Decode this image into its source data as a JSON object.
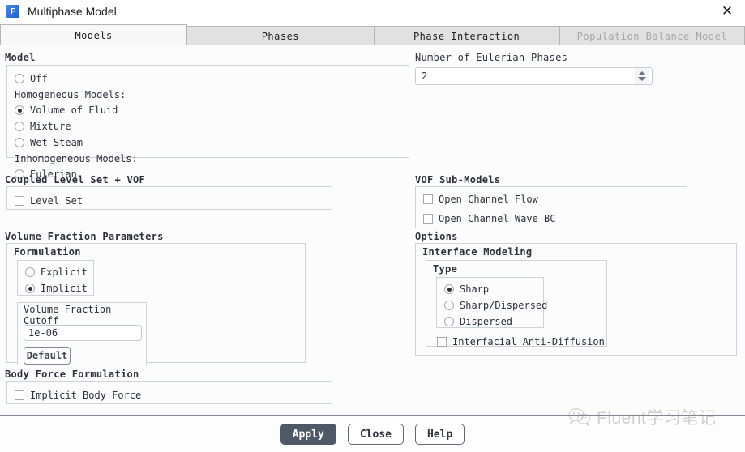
{
  "window": {
    "title": "Multiphase Model",
    "app_icon": "fluent-logo-icon",
    "app_icon_letter": "F",
    "close_icon": "✕"
  },
  "tabs": [
    {
      "label": "Models",
      "state": "active"
    },
    {
      "label": "Phases",
      "state": "normal"
    },
    {
      "label": "Phase Interaction",
      "state": "normal"
    },
    {
      "label": "Population Balance Model",
      "state": "disabled"
    }
  ],
  "model": {
    "title": "Model",
    "off": {
      "label": "Off",
      "selected": false
    },
    "homogeneous_label": "Homogeneous Models:",
    "homogeneous": [
      {
        "label": "Volume of Fluid",
        "selected": true
      },
      {
        "label": "Mixture",
        "selected": false
      },
      {
        "label": "Wet Steam",
        "selected": false
      }
    ],
    "inhomogeneous_label": "Inhomogeneous Models:",
    "inhomogeneous": [
      {
        "label": "Eulerian",
        "selected": false
      }
    ]
  },
  "eulerian_phases": {
    "title": "Number of Eulerian Phases",
    "value": "2"
  },
  "coupled_level_set": {
    "title": "Coupled Level Set + VOF",
    "level_set": {
      "label": "Level Set",
      "checked": false
    }
  },
  "vof_sub_models": {
    "title": "VOF Sub-Models",
    "items": [
      {
        "label": "Open Channel Flow",
        "checked": false
      },
      {
        "label": "Open Channel Wave BC",
        "checked": false
      }
    ]
  },
  "volume_fraction_parameters": {
    "title": "Volume Fraction Parameters",
    "formulation": {
      "title": "Formulation",
      "options": [
        {
          "label": "Explicit",
          "selected": false
        },
        {
          "label": "Implicit",
          "selected": true
        }
      ]
    },
    "cutoff": {
      "title": "Volume Fraction Cutoff",
      "value": "1e-06",
      "default_button": "Default"
    }
  },
  "options": {
    "title": "Options",
    "interface_modeling": {
      "title": "Interface Modeling",
      "type": {
        "title": "Type",
        "options": [
          {
            "label": "Sharp",
            "selected": true
          },
          {
            "label": "Sharp/Dispersed",
            "selected": false
          },
          {
            "label": "Dispersed",
            "selected": false
          }
        ]
      },
      "anti_diffusion": {
        "label": "Interfacial Anti-Diffusion",
        "checked": false
      }
    }
  },
  "body_force_formulation": {
    "title": "Body Force Formulation",
    "implicit_body_force": {
      "label": "Implicit Body Force",
      "checked": false
    }
  },
  "footer": {
    "apply": "Apply",
    "close": "Close",
    "help": "Help"
  },
  "watermark": {
    "text": "Fluent学习笔记",
    "icon": "wechat-icon"
  },
  "colors": {
    "primary_button": "#4f5866",
    "panel_border": "#ccd3dd",
    "tab_border": "#b4b4b4",
    "text": "#2b303b",
    "disabled_text": "#a6a6a6",
    "app_icon_blue": "#2f6fd0"
  }
}
